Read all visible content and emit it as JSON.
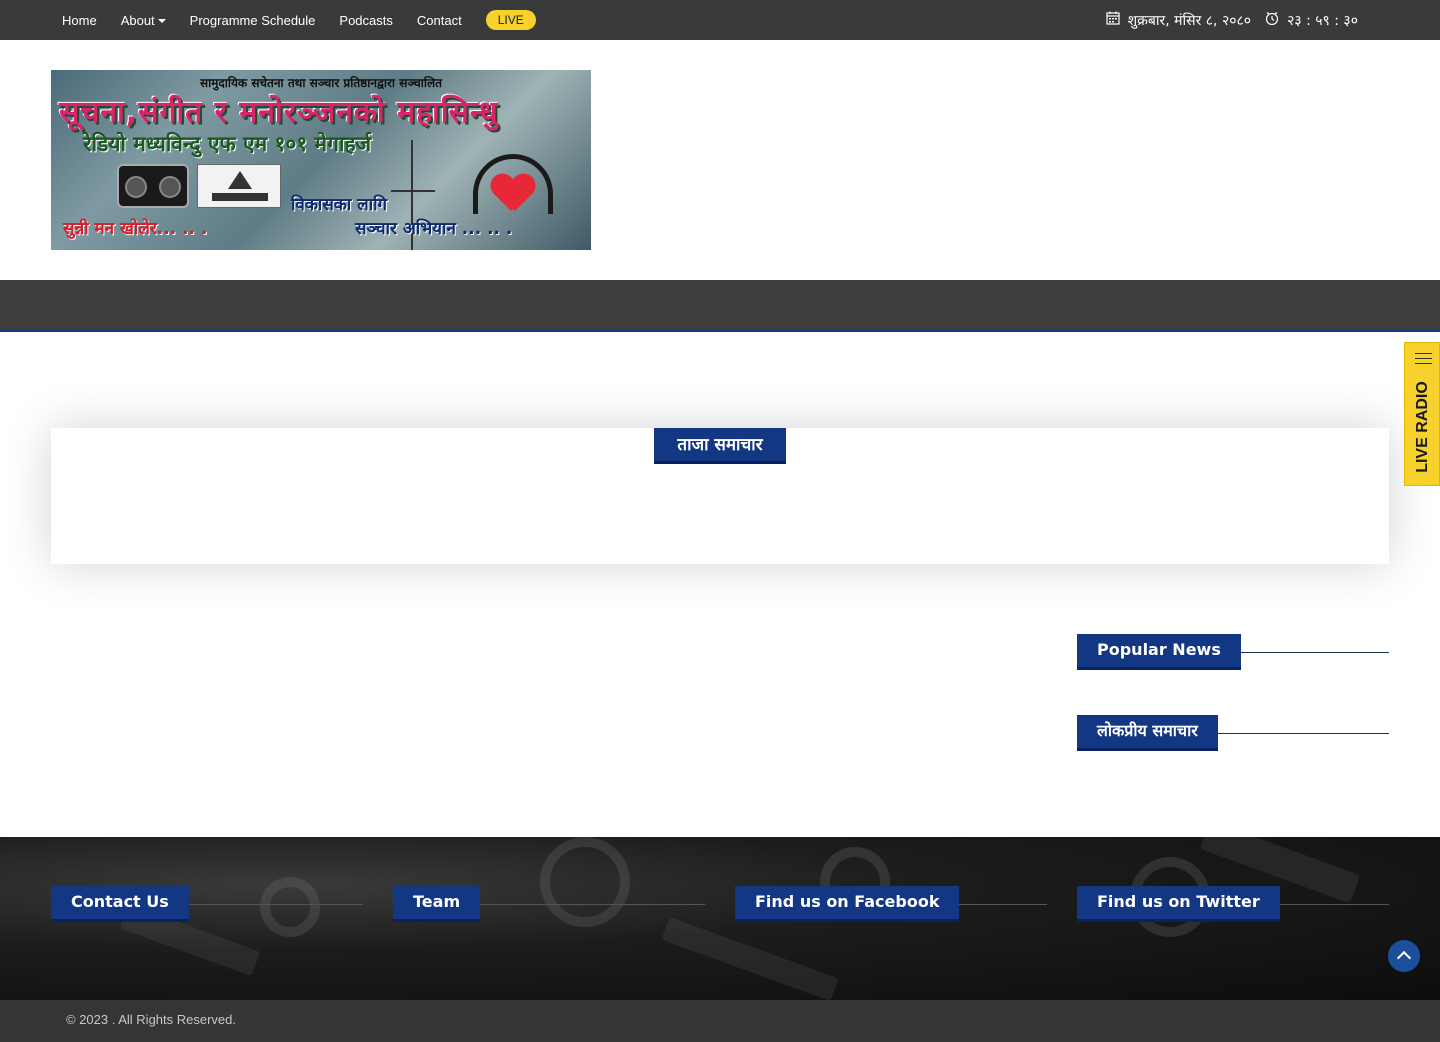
{
  "topbar": {
    "nav": [
      {
        "label": "Home"
      },
      {
        "label": "About"
      },
      {
        "label": "Programme Schedule"
      },
      {
        "label": "Podcasts"
      },
      {
        "label": "Contact"
      }
    ],
    "live_label": "LIVE",
    "date": "शुक्रबार, मंसिर ८, २०८०",
    "time": "२३ : ५९ : ३०",
    "date_icon": "calendar-icon",
    "time_icon": "clock-icon"
  },
  "banner": {
    "top_line": "सामुदायिक सचेतना तथा सञ्चार प्रतिष्ठानद्वारा सञ्चालित",
    "headline": "सूचना,संगीत र मनोरञ्जनको महासिन्धु",
    "station": "रेडियो मध्यविन्दु एफ एम १०१ मेगाहर्ज",
    "slogan_1": "विकासका लागि",
    "slogan_2": "सुन्नी मन खोलेर... .. .",
    "slogan_3": "सञ्चार अभियान ... .. ."
  },
  "latest_news": {
    "title": "ताजा समाचार"
  },
  "sidebar": {
    "popular_news": "Popular News",
    "popular_news_np": "लोकप्रीय समाचार"
  },
  "live_tab": {
    "label": "LIVE RADIO",
    "icon": "menu-icon"
  },
  "footer": {
    "contact": "Contact Us",
    "team": "Team",
    "facebook": "Find us on Facebook",
    "twitter": "Find us on Twitter",
    "copyright": "© 2023 . All Rights Reserved."
  },
  "colors": {
    "topbar": "#3a3a3a",
    "accent_blue": "#133782",
    "live_yellow": "#f7d12c"
  }
}
